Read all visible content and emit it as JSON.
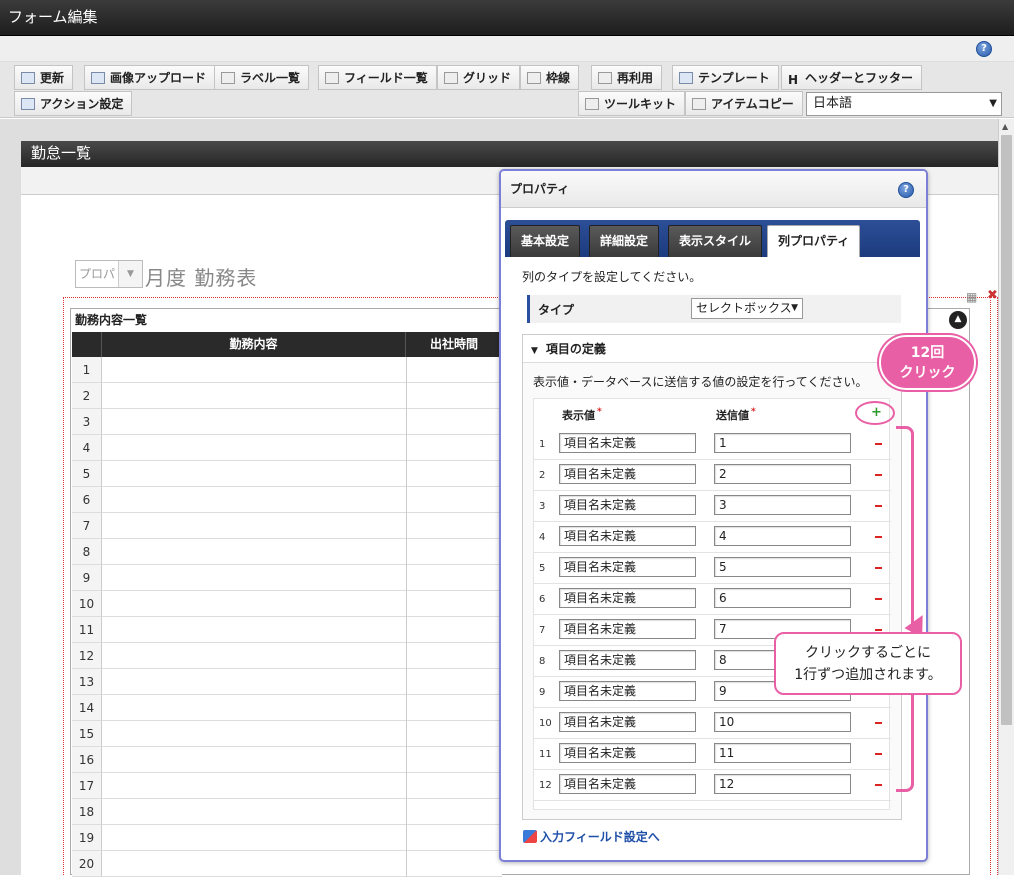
{
  "window": {
    "title": "フォーム編集"
  },
  "toolbar": {
    "row1": [
      "更新",
      "画像アップロード",
      "ラベル一覧",
      "フィールド一覧",
      "グリッド",
      "枠線",
      "再利用",
      "テンプレート",
      "ヘッダーとフッター"
    ],
    "row2_left": "アクション設定",
    "toolkit": "ツールキット",
    "item_copy": "アイテムコピー",
    "language": "日本語"
  },
  "form": {
    "header": "勤怠一覧",
    "month_select_placeholder": "プロパ",
    "month_title": "月度 勤務表",
    "list_title": "勤務内容一覧",
    "columns": [
      "勤務内容",
      "出社時間"
    ],
    "row_numbers": [
      "1",
      "2",
      "3",
      "4",
      "5",
      "6",
      "7",
      "8",
      "9",
      "10",
      "11",
      "12",
      "13",
      "14",
      "15",
      "16",
      "17",
      "18",
      "19",
      "20"
    ]
  },
  "panel": {
    "title": "プロパティ",
    "tabs": [
      "基本設定",
      "詳細設定",
      "表示スタイル",
      "列プロパティ"
    ],
    "active_tab": "列プロパティ",
    "description": "列のタイプを設定してください。",
    "type_label": "タイプ",
    "type_value": "セレクトボックス",
    "section_title": "項目の定義",
    "section_description": "表示値・データベースに送信する値の設定を行ってください。",
    "col_display": "表示値",
    "col_send": "送信値",
    "required_mark": "*",
    "rows": [
      {
        "num": "1",
        "display": "項目名未定義",
        "value": "1"
      },
      {
        "num": "2",
        "display": "項目名未定義",
        "value": "2"
      },
      {
        "num": "3",
        "display": "項目名未定義",
        "value": "3"
      },
      {
        "num": "4",
        "display": "項目名未定義",
        "value": "4"
      },
      {
        "num": "5",
        "display": "項目名未定義",
        "value": "5"
      },
      {
        "num": "6",
        "display": "項目名未定義",
        "value": "6"
      },
      {
        "num": "7",
        "display": "項目名未定義",
        "value": "7"
      },
      {
        "num": "8",
        "display": "項目名未定義",
        "value": "8"
      },
      {
        "num": "9",
        "display": "項目名未定義",
        "value": "9"
      },
      {
        "num": "10",
        "display": "項目名未定義",
        "value": "10"
      },
      {
        "num": "11",
        "display": "項目名未定義",
        "value": "11"
      },
      {
        "num": "12",
        "display": "項目名未定義",
        "value": "12"
      }
    ],
    "link": "入力フィールド設定へ"
  },
  "callouts": {
    "click_line1": "12回",
    "click_line2": "クリック",
    "note_line1": "クリックするごとに",
    "note_line2": "1行ずつ追加されます。"
  },
  "colors": {
    "accent": "#e95fa5",
    "tabbar": "#1d3b7e",
    "panel_border": "#7b7fd6"
  }
}
